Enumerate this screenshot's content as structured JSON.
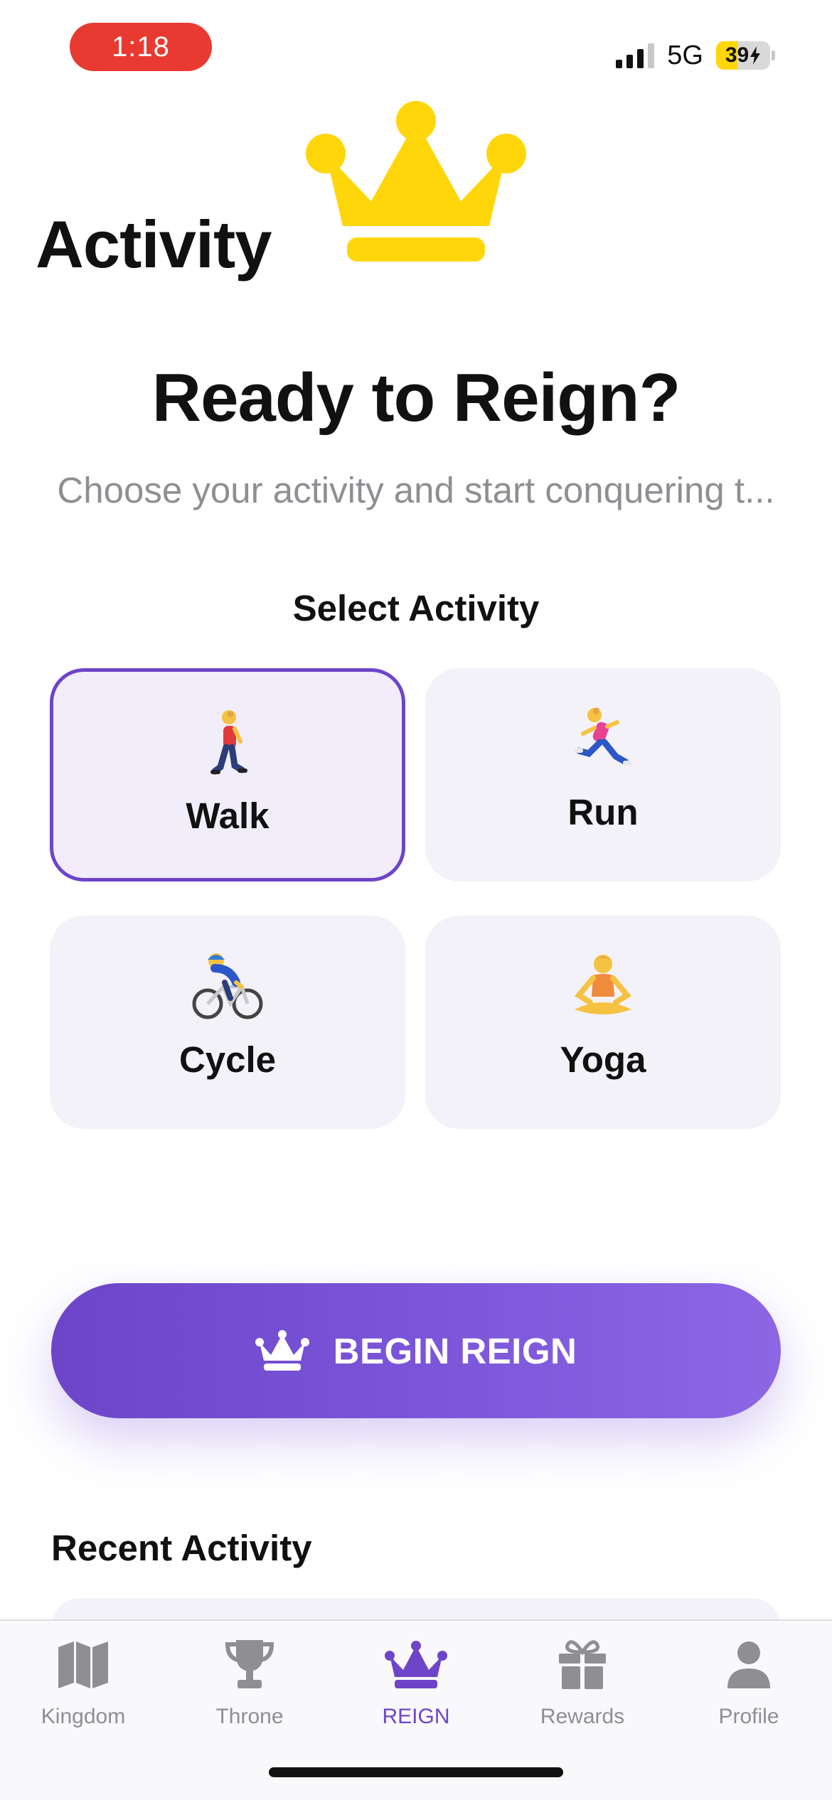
{
  "status_bar": {
    "time": "1:18",
    "network": "5G",
    "battery_percent": "39",
    "battery_level": 0.39
  },
  "header": {
    "title": "Activity",
    "logo_icon": "crown-icon",
    "logo_color": "#FFD60A"
  },
  "hero": {
    "title": "Ready to Reign?",
    "subtitle": "Choose your activity and start conquering t..."
  },
  "activity_section": {
    "label": "Select Activity",
    "selected": "Walk",
    "options": [
      {
        "label": "Walk",
        "icon": "person-walking-icon"
      },
      {
        "label": "Run",
        "icon": "person-running-icon"
      },
      {
        "label": "Cycle",
        "icon": "person-biking-icon"
      },
      {
        "label": "Yoga",
        "icon": "person-lotus-icon"
      }
    ]
  },
  "begin_button": {
    "label": "BEGIN REIGN",
    "icon": "crown-icon"
  },
  "recent": {
    "title": "Recent Activity"
  },
  "tabbar": {
    "active": "REIGN",
    "items": [
      {
        "label": "Kingdom",
        "icon": "map-icon"
      },
      {
        "label": "Throne",
        "icon": "trophy-icon"
      },
      {
        "label": "REIGN",
        "icon": "crown-icon"
      },
      {
        "label": "Rewards",
        "icon": "gift-icon"
      },
      {
        "label": "Profile",
        "icon": "person-icon"
      }
    ]
  },
  "colors": {
    "accent": "#6E44C9",
    "accent_light": "#8D66E4",
    "card_bg": "#F3F2F8",
    "selected_card_bg": "#F1EDFB",
    "inactive_tab": "#8E8E93",
    "status_time_bg": "#E93A32"
  }
}
